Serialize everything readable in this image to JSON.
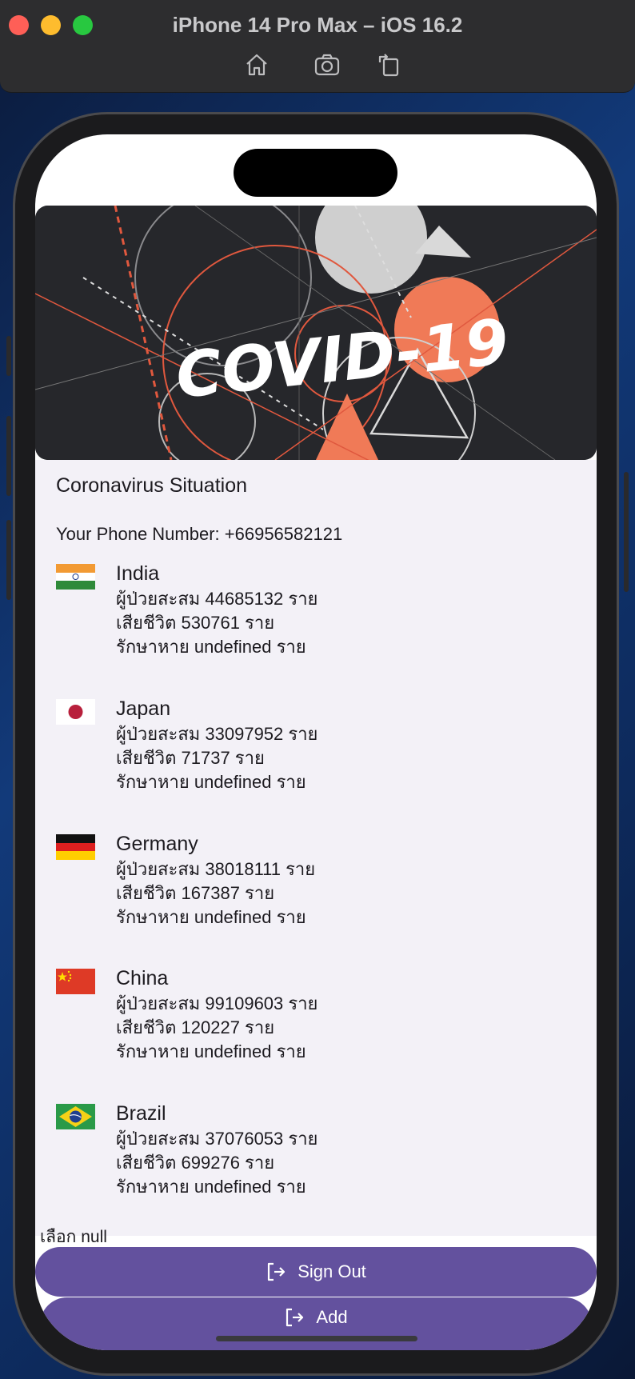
{
  "simulator": {
    "title": "iPhone 14 Pro Max – iOS 16.2",
    "toolbar": [
      "home-icon",
      "screenshot-icon",
      "rotate-icon"
    ]
  },
  "app": {
    "hero_text": "COVID-19",
    "section_title": "Coronavirus Situation",
    "phone_line": "Your Phone Number: +66956582121",
    "countries": [
      {
        "name": "India",
        "cases": "ผู้ป่วยสะสม 44685132 ราย",
        "deaths": "เสียชีวิต 530761 ราย",
        "recovered": "รักษาหาย undefined ราย"
      },
      {
        "name": "Japan",
        "cases": "ผู้ป่วยสะสม 33097952 ราย",
        "deaths": "เสียชีวิต 71737 ราย",
        "recovered": "รักษาหาย undefined ราย"
      },
      {
        "name": "Germany",
        "cases": "ผู้ป่วยสะสม 38018111 ราย",
        "deaths": "เสียชีวิต 167387 ราย",
        "recovered": "รักษาหาย undefined ราย"
      },
      {
        "name": "China",
        "cases": "ผู้ป่วยสะสม 99109603 ราย",
        "deaths": "เสียชีวิต 120227 ราย",
        "recovered": "รักษาหาย undefined ราย"
      },
      {
        "name": "Brazil",
        "cases": "ผู้ป่วยสะสม 37076053 ราย",
        "deaths": "เสียชีวิต 699276 ราย",
        "recovered": "รักษาหาย undefined ราย"
      }
    ],
    "selected_text": "เลือก null",
    "sign_out_label": "Sign Out",
    "add_label": "Add"
  },
  "colors": {
    "button": "#63519e",
    "content_bg": "#f3f1f7",
    "accent_orange": "#f07a57"
  }
}
